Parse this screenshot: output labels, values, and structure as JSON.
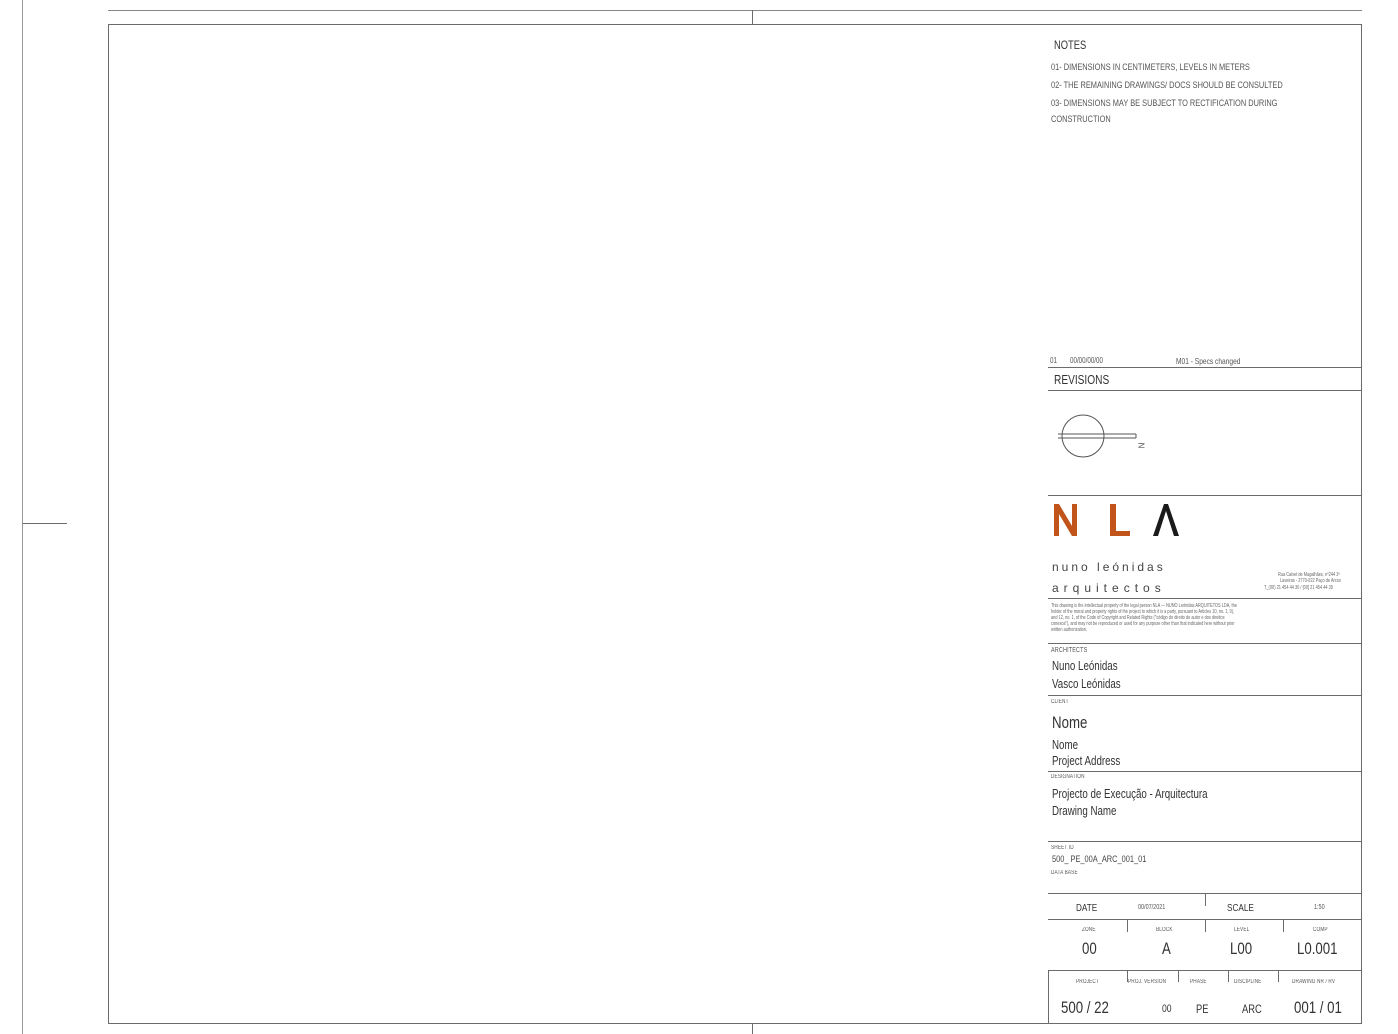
{
  "notes": {
    "title": "NOTES",
    "items": [
      "01- DIMENSIONS IN CENTIMETERS, LEVELS IN METERS",
      "02- THE REMAINING DRAWINGS/ DOCS SHOULD BE CONSULTED",
      "03- DIMENSIONS MAY BE SUBJECT TO RECTIFICATION DURING",
      "CONSTRUCTION"
    ]
  },
  "revisions": {
    "title": "REVISIONS",
    "row": {
      "number": "01",
      "date": "00/00/00/00",
      "description": "M01 - Specs changed"
    }
  },
  "north_arrow": {
    "icon": "north-arrow-icon",
    "label": "N"
  },
  "logo": {
    "letters": "N L Λ",
    "line1": "nuno leónidas",
    "line2": "arquitectos",
    "accent_color": "#c0541a",
    "dark_color": "#1a1a1a"
  },
  "office_address": [
    "Rua Calvet de Magalhães, nº244 3º",
    "Laveiras - 2770-022 Paço de Arcos",
    "T_(00) 21 454 44 30 / [00] 21 454 44 39"
  ],
  "copyright": [
    "This drawing is the intellectual property of the legal person NLA — NUNO Leónidas ARQUITETOS LDA, the",
    "holder of the moral and property rights of the project to which it is a party, pursuant to Articles 10, no. 1, 9),",
    "and 12, no. 1, of the Code of Copyright and Related Rights (\"código do direito de autor e dos direitos",
    "conexos\"), and may not be reproduced or used for any purpose other than that indicated here without prior",
    "written authorization."
  ],
  "architects": {
    "label": "ARCHITECTS",
    "names": [
      "Nuno Leónidas",
      "Vasco Leónidas"
    ]
  },
  "client": {
    "label": "CLIENT",
    "name": "Nome",
    "name2": "Nome",
    "address": "Project Address"
  },
  "designation": {
    "label": "DESIGNATION",
    "line1": "Projecto de Execução - Arquitectura",
    "line2": "Drawing Name"
  },
  "sheet": {
    "id_label": "SHEET ID",
    "id_value": "500_ PE_00A_ARC_001_01",
    "database_label": "DATA BASE"
  },
  "info": {
    "date_label": "DATE",
    "date_value": "00/07/2021",
    "scale_label": "SCALE",
    "scale_value": "1:50",
    "zone_label": "ZONE",
    "zone_value": "00",
    "block_label": "BLOCK",
    "block_value": "A",
    "level_label": "LEVEL",
    "level_value": "L00",
    "comp_label": "COMP",
    "comp_value": "L0.001",
    "project_label": "PROJECT",
    "project_value": "500 / 22",
    "projversion_label": "PROJ. VERSION",
    "projversion_value": "00",
    "phase_label": "PHASE",
    "phase_value": "PE",
    "discipline_label": "DISCIPLINE",
    "discipline_value": "ARC",
    "drawingnr_label": "DRAWING NR / RV",
    "drawingnr_value": "001 / 01"
  }
}
